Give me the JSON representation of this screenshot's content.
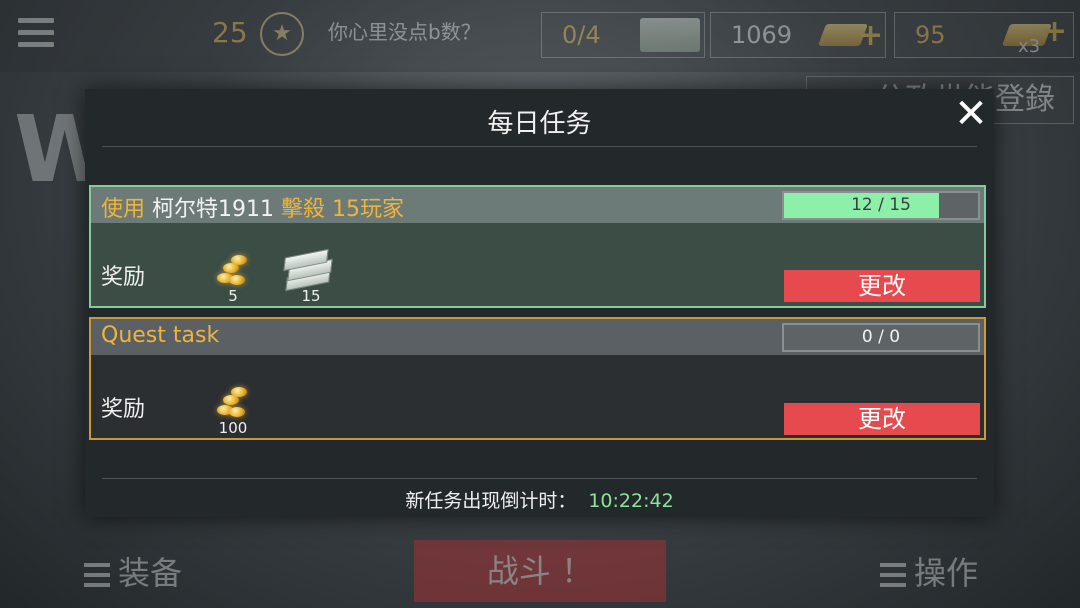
{
  "hud": {
    "level": "25",
    "player_name": "你心里没点b数？",
    "ammo": "0/4",
    "cash": "1069",
    "gold": "95",
    "gold_multiplier": "x3",
    "right_button": "分政世能登錄",
    "title_partial": "W"
  },
  "bottom_nav": {
    "equipment": "装备",
    "fight": "战斗 ！",
    "controls": "操作"
  },
  "dialog": {
    "title": "每日任务",
    "close_icon": "✕",
    "quests": [
      {
        "parts": [
          {
            "text": "使用 ",
            "style": "gold"
          },
          {
            "text": "柯尔特1911 ",
            "style": "white"
          },
          {
            "text": "擊殺 15玩家",
            "style": "gold"
          }
        ],
        "progress_label": "12 / 15",
        "progress_current": 12,
        "progress_total": 15,
        "reward_label": "奖励",
        "rewards": [
          {
            "icon": "gold-coins-icon",
            "count": "5"
          },
          {
            "icon": "cash-stack-icon",
            "count": "15"
          }
        ],
        "change_label": "更改"
      },
      {
        "parts": [
          {
            "text": "Quest task",
            "style": "gold"
          }
        ],
        "progress_label": "0 / 0",
        "progress_current": 0,
        "progress_total": 0,
        "reward_label": "奖励",
        "rewards": [
          {
            "icon": "gold-coins-icon",
            "count": "100"
          }
        ],
        "change_label": "更改"
      }
    ],
    "timer_label": "新任务出现倒计时：",
    "timer_value": "10:22:42"
  },
  "colors": {
    "active_border": "#86c99d",
    "pending_border": "#c99a3a",
    "change_button": "#e64a4e",
    "progress_fill": "#8df0a8",
    "accent_gold": "#f0b43a"
  }
}
